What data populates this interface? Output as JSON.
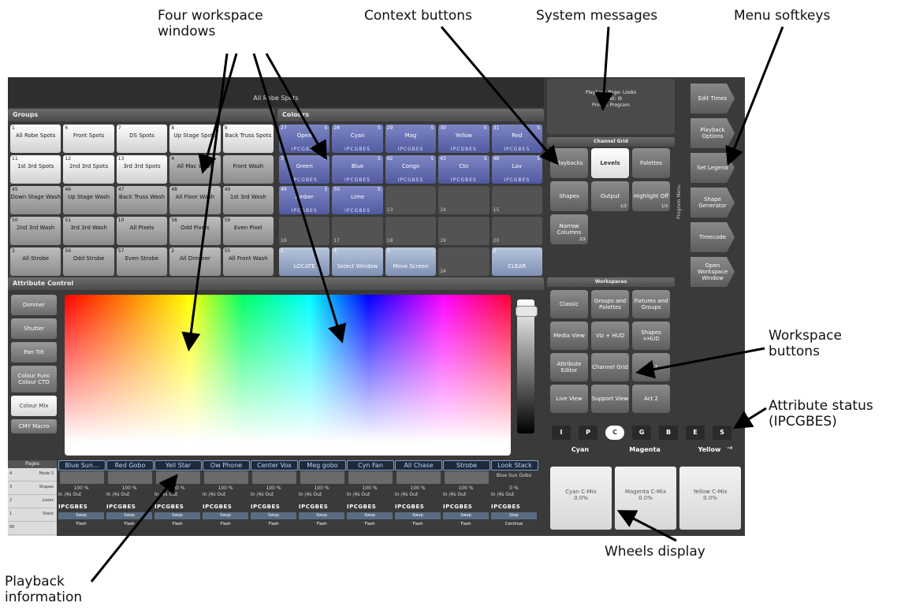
{
  "callouts": {
    "workspaces": "Four workspace\nwindows",
    "context": "Context buttons",
    "system": "System messages",
    "menu": "Menu softkeys",
    "ws_buttons": "Workspace\nbuttons",
    "attr_status": "Attribute status\n(IPCGBES)",
    "wheels": "Wheels display",
    "playback": "Playback\ninformation"
  },
  "screen": {
    "title": "All Robe Spots",
    "system_message": {
      "l1": "Playback Page: Looks",
      "l2": "Preset: I9",
      "l3": "Profile: Program"
    },
    "groups": {
      "header": "Groups",
      "cells": [
        {
          "n": "1",
          "label": "All Robe Spots",
          "style": "white"
        },
        {
          "n": "6",
          "label": "Front Spots",
          "style": "white"
        },
        {
          "n": "7",
          "label": "DS Spots",
          "style": "white"
        },
        {
          "n": "8",
          "label": "Up Stage Spots",
          "style": "white"
        },
        {
          "n": "9",
          "label": "Back Truss Spots",
          "style": "white"
        },
        {
          "n": "11",
          "label": "1st 3rd Spots",
          "style": "white"
        },
        {
          "n": "12",
          "label": "2nd 3rd Spots",
          "style": "white"
        },
        {
          "n": "13",
          "label": "3rd 3rd Spots",
          "style": "white"
        },
        {
          "n": "4",
          "label": "All Mac Wash",
          "style": "grey"
        },
        {
          "n": "",
          "label": "Front Wash",
          "style": "grey"
        },
        {
          "n": "45",
          "label": "Down Stage Wash",
          "style": "grey"
        },
        {
          "n": "46",
          "label": "Up Stage Wash",
          "style": "grey"
        },
        {
          "n": "47",
          "label": "Back Truss Wash",
          "style": "grey"
        },
        {
          "n": "48",
          "label": "All Floor Wash",
          "style": "grey"
        },
        {
          "n": "49",
          "label": "1st 3rd Wash",
          "style": "grey"
        },
        {
          "n": "50",
          "label": "2nd 3rd Wash",
          "style": "grey"
        },
        {
          "n": "51",
          "label": "3rd 3rd Wash",
          "style": "grey"
        },
        {
          "n": "10",
          "label": "All Pixels",
          "style": "grey"
        },
        {
          "n": "58",
          "label": "Odd Pixels",
          "style": "grey"
        },
        {
          "n": "59",
          "label": "Even Pixel",
          "style": "grey"
        },
        {
          "n": "3",
          "label": "All Strobe",
          "style": "grey"
        },
        {
          "n": "56",
          "label": "Odd Strobe",
          "style": "grey"
        },
        {
          "n": "57",
          "label": "Even Strobe",
          "style": "grey"
        },
        {
          "n": "2",
          "label": "All Dimmer",
          "style": "grey"
        },
        {
          "n": "55",
          "label": "All Front Wash",
          "style": "grey"
        }
      ]
    },
    "colours": {
      "header": "Colours",
      "ipc_sub": "IPCGBES",
      "cells": [
        {
          "n": "27",
          "label": "Open",
          "type": "blue",
          "s": "S"
        },
        {
          "n": "28",
          "label": "Cyan",
          "type": "blue",
          "s": "S"
        },
        {
          "n": "29",
          "label": "Mag",
          "type": "blue",
          "s": "S"
        },
        {
          "n": "30",
          "label": "Yellow",
          "type": "blue",
          "s": "S"
        },
        {
          "n": "31",
          "label": "Red",
          "type": "blue",
          "s": "S"
        },
        {
          "n": "3",
          "label": "Green",
          "type": "blue",
          "s": "S"
        },
        {
          "n": "",
          "label": "Blue",
          "type": "blue",
          "s": "S"
        },
        {
          "n": "42",
          "label": "Congo",
          "type": "blue",
          "s": "S"
        },
        {
          "n": "43",
          "label": "Cto",
          "type": "blue",
          "s": "S"
        },
        {
          "n": "48",
          "label": "Lav",
          "type": "blue",
          "s": "S"
        },
        {
          "n": "49",
          "label": "Amber",
          "type": "blue",
          "s": "S"
        },
        {
          "n": "50",
          "label": "Lime",
          "type": "blue",
          "s": "S"
        },
        {
          "n": "13",
          "label": "",
          "type": "empty",
          "s": ""
        },
        {
          "n": "14",
          "label": "",
          "type": "empty",
          "s": ""
        },
        {
          "n": "15",
          "label": "",
          "type": "empty",
          "s": ""
        },
        {
          "n": "16",
          "label": "",
          "type": "empty",
          "s": ""
        },
        {
          "n": "17",
          "label": "",
          "type": "empty",
          "s": ""
        },
        {
          "n": "18",
          "label": "",
          "type": "empty",
          "s": ""
        },
        {
          "n": "19",
          "label": "",
          "type": "empty",
          "s": ""
        },
        {
          "n": "20",
          "label": "",
          "type": "empty",
          "s": ""
        },
        {
          "n": "1",
          "label": "LOCATE",
          "type": "btn",
          "s": ""
        },
        {
          "n": "4",
          "label": "Select Window",
          "type": "btn",
          "s": ""
        },
        {
          "n": "3",
          "label": "Move Screen",
          "type": "btn",
          "s": ""
        },
        {
          "n": "24",
          "label": "",
          "type": "empty",
          "s": ""
        },
        {
          "n": "2",
          "label": "CLEAR",
          "type": "btn",
          "s": ""
        }
      ]
    },
    "channel_grid": {
      "header": "Channel Grid",
      "buttons": [
        {
          "label": "Playbacks"
        },
        {
          "label": "Levels"
        },
        {
          "label": "Palettes"
        },
        {
          "label": "Shapes"
        },
        {
          "label": "Output",
          "page": "1/2"
        },
        {
          "label": "Highlight Off",
          "page": "1/3"
        },
        {
          "label": "Narrow Columns",
          "page": "2/2"
        }
      ]
    },
    "program_menu_label": "Program Menu",
    "softkeys": [
      "Edit Times",
      "Playback Options",
      "Set Legend",
      "Shape Generator",
      "Timecode",
      "Open Workspace Window"
    ],
    "workspaces": {
      "header": "Workspaces",
      "buttons": [
        "Classic",
        "Groups and Palettes",
        "Fixtures and Groups",
        "Media View",
        "Viz + HUD",
        "Shapes +HUD",
        "Attribute Editor",
        "Channel Grid",
        "Act 1",
        "Live View",
        "Support View",
        "Act 2"
      ]
    },
    "attribute_control": {
      "header": "Attribute Control",
      "buttons": [
        "Dimmer",
        "Shutter",
        "Pan Tilt",
        "Colour Func Colour CTO",
        "Colour Mix",
        "CMY Macro"
      ]
    },
    "ipcgbes": [
      "I",
      "P",
      "C",
      "G",
      "B",
      "E",
      "S"
    ],
    "wheels": {
      "headers": [
        "Cyan",
        "Magenta",
        "Yellow"
      ],
      "more": "→",
      "values": [
        {
          "name": "Cyan C-Mix",
          "val": "0.0%"
        },
        {
          "name": "Magenta C-Mix",
          "val": "0.0%"
        },
        {
          "name": "Yellow C-Mix",
          "val": "0.0%"
        }
      ]
    },
    "pages": {
      "header": "Pages",
      "rows": [
        {
          "n": "4",
          "label": "Mode 3"
        },
        {
          "n": "3",
          "label": "Shapes"
        },
        {
          "n": "2",
          "label": "Looks"
        },
        {
          "n": "1",
          "label": "Stack"
        },
        {
          "n": "60",
          "label": ""
        }
      ]
    },
    "playbacks": [
      {
        "name": "Blue Sun...",
        "pct": "100 %",
        "fade": "In /4s  Out",
        "attr": "IPCGBES",
        "k1": "Swop",
        "k2": "Flash"
      },
      {
        "name": "Red Gobo",
        "pct": "100 %",
        "fade": "In /4s  Out",
        "attr": "IPCGBES",
        "k1": "Swop",
        "k2": "Flash"
      },
      {
        "name": "Yell Star",
        "pct": "100 %",
        "fade": "In /4s  Out",
        "attr": "IPCGBES",
        "k1": "Swop",
        "k2": "Flash"
      },
      {
        "name": "Ow Phone",
        "pct": "100 %",
        "fade": "In /4s  Out",
        "attr": "IPCGBES",
        "k1": "Swop",
        "k2": "Flash"
      },
      {
        "name": "Center Vox",
        "pct": "100 %",
        "fade": "In /4s  Out",
        "attr": "IPCGBES",
        "k1": "Swop",
        "k2": "Flash"
      },
      {
        "name": "Meg gobo",
        "pct": "100 %",
        "fade": "In /4s  Out",
        "attr": "IPCGBES",
        "k1": "Swop",
        "k2": "Flash"
      },
      {
        "name": "Cyn Fan",
        "pct": "100 %",
        "fade": "In /4s  Out",
        "attr": "IPCGBES",
        "k1": "Swop",
        "k2": "Flash"
      },
      {
        "name": "All Chase",
        "pct": "100 %",
        "fade": "In /4s  Out",
        "attr": "IPCGBES",
        "k1": "Swop",
        "k2": "Flash"
      },
      {
        "name": "Strobe",
        "pct": "100 %",
        "fade": "In /4s  Out",
        "attr": "IPCGBES",
        "k1": "Swop",
        "k2": "Flash"
      },
      {
        "name": "Look Stack",
        "pct": "0 %",
        "fade": "In /4s  Out",
        "attr": "IPCGBES",
        "k1": "Step",
        "k2": "Continue",
        "sub": "Blue Sun Gobo"
      }
    ]
  }
}
